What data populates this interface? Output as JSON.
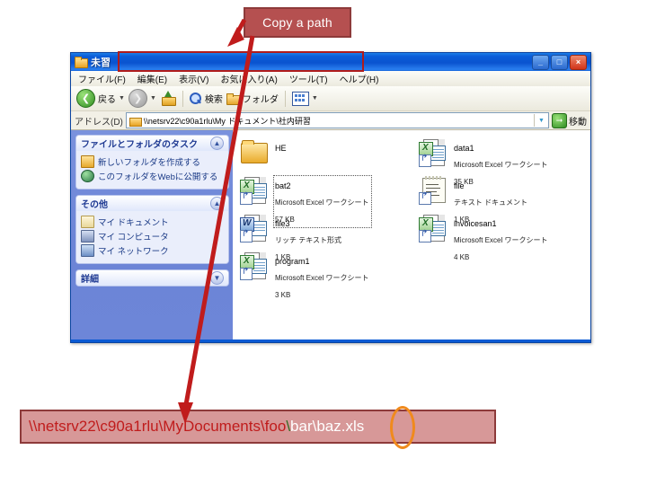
{
  "callout": {
    "label": "Copy a path"
  },
  "window": {
    "title": "未習",
    "title_icon": "folder-icon",
    "controls": [
      {
        "name": "minimize",
        "glyph": "_"
      },
      {
        "name": "maximize",
        "glyph": "□"
      },
      {
        "name": "close",
        "glyph": "×"
      }
    ],
    "menubar": [
      "ファイル(F)",
      "編集(E)",
      "表示(V)",
      "お気に入り(A)",
      "ツール(T)",
      "ヘルプ(H)"
    ],
    "toolbar": {
      "back": "戻る",
      "forward": "",
      "up": "",
      "search": "検索",
      "folders": "フォルダ",
      "views": ""
    },
    "address": {
      "label": "アドレス(D)",
      "value": "\\\\netsrv22\\c90a1rlu\\My ドキュメント\\社内研習",
      "go_label": "移動"
    }
  },
  "taskpane": {
    "groups": [
      {
        "title": "ファイルとフォルダのタスク",
        "items": [
          {
            "label": "新しいフォルダを作成する",
            "icon": "new-folder-icon"
          },
          {
            "label": "このフォルダをWebに公開する",
            "icon": "publish-web-icon"
          }
        ]
      },
      {
        "title": "その他",
        "items": [
          {
            "label": "マイ ドキュメント",
            "icon": "my-documents-icon"
          },
          {
            "label": "マイ コンピュータ",
            "icon": "my-computer-icon"
          },
          {
            "label": "マイ ネットワーク",
            "icon": "my-network-icon"
          }
        ]
      },
      {
        "title": "詳細",
        "items": []
      }
    ]
  },
  "files": [
    {
      "name": "HE",
      "type": "",
      "size": "",
      "icon": "folder-icon",
      "selected": false
    },
    {
      "name": "data1",
      "type": "Microsoft Excel ワークシート",
      "size": "35 KB",
      "icon": "excel-shortcut-icon",
      "selected": false
    },
    {
      "name": "bat2",
      "type": "Microsoft Excel ワークシート",
      "size": "57 KB",
      "icon": "excel-shortcut-icon",
      "selected": true
    },
    {
      "name": "file",
      "type": "テキスト ドキュメント",
      "size": "1 KB",
      "icon": "text-shortcut-icon",
      "selected": false
    },
    {
      "name": "file3",
      "type": "リッチ テキスト形式",
      "size": "1 KB",
      "icon": "word-shortcut-icon",
      "selected": false
    },
    {
      "name": "invoicesan1",
      "type": "Microsoft Excel ワークシート",
      "size": "4 KB",
      "icon": "excel-shortcut-icon",
      "selected": false
    },
    {
      "name": "program1",
      "type": "Microsoft Excel ワークシート",
      "size": "3 KB",
      "icon": "excel-shortcut-icon",
      "selected": false
    }
  ],
  "path_banner": {
    "segment_red": "\\\\netsrv22\\c90a1rlu\\MyDocuments\\foo",
    "segment_green": "\\",
    "segment_white": "bar\\baz.xls",
    "highlight_target": "b"
  },
  "colors": {
    "callout_bg": "#b55050",
    "callout_border": "#8d3a3a",
    "banner_bg": "#d79898",
    "banner_border": "#8d3a3a",
    "arrow": "#c01c1c",
    "ellipse": "#f08a1d",
    "titlebar": "#0a5ad4",
    "path_red": "#c01c1c",
    "path_green": "#2e6b1e",
    "path_white": "#ffffff"
  }
}
